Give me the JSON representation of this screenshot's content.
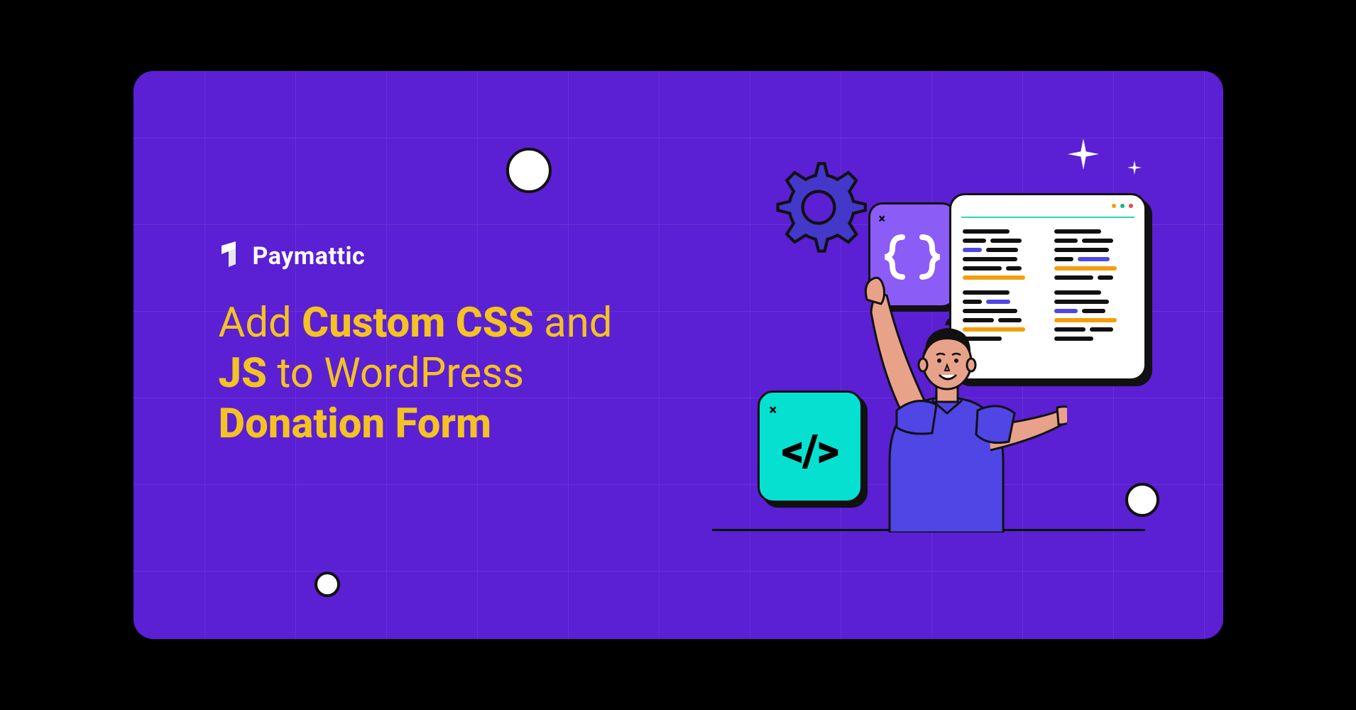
{
  "brand": {
    "name": "Paymattic"
  },
  "heading": {
    "part1": "Add ",
    "bold1": "Custom CSS",
    "part2": " and ",
    "bold2": "JS",
    "part3": " to WordPress ",
    "bold3": "Donation Form"
  },
  "braces_card": {
    "close_glyph": "×"
  },
  "tag_card": {
    "close_glyph": "×",
    "glyph": "</>"
  },
  "colors": {
    "background": "#5b1fd4",
    "heading": "#f4c222",
    "teal": "#06e0d1",
    "violet": "#8b5cf6"
  }
}
